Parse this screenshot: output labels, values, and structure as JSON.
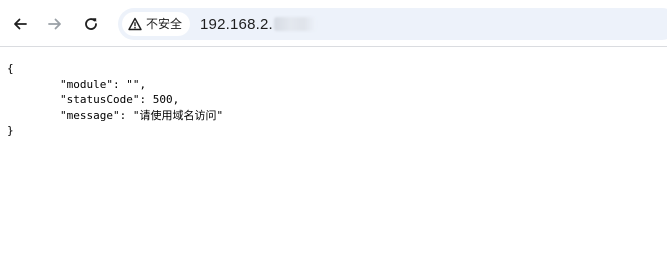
{
  "toolbar": {
    "back_icon": "arrow-left-icon",
    "forward_icon": "arrow-right-icon",
    "reload_icon": "reload-icon",
    "security_icon": "warning-triangle-icon",
    "security_label": "不安全",
    "url_visible": "192.168.2."
  },
  "json_body": {
    "lines": [
      "{",
      "        \"module\": \"\",",
      "        \"statusCode\": 500,",
      "        \"message\": \"请使用域名访问\"",
      "}"
    ]
  }
}
